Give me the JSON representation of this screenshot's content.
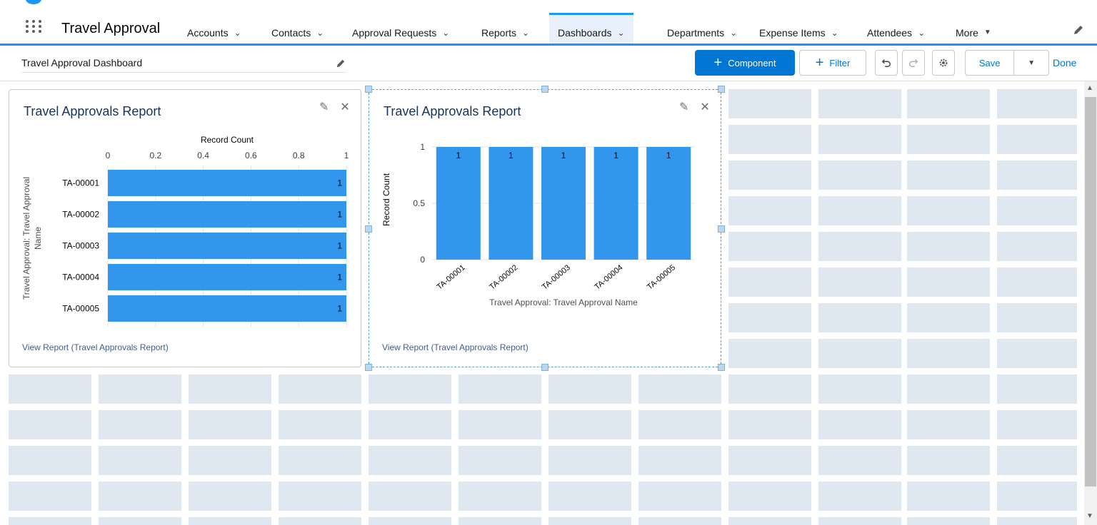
{
  "app": {
    "name": "Travel Approval"
  },
  "nav": {
    "items": [
      {
        "label": "Accounts",
        "left": 250
      },
      {
        "label": "Contacts",
        "left": 368
      },
      {
        "label": "Approval Requests",
        "left": 481
      },
      {
        "label": "Reports",
        "left": 662
      },
      {
        "label": "Dashboards",
        "left": 769
      },
      {
        "label": "Departments",
        "left": 922
      },
      {
        "label": "Expense Items",
        "left": 1051
      },
      {
        "label": "Attendees",
        "left": 1202
      }
    ],
    "more_label": "More"
  },
  "dashboard": {
    "title": "Travel Approval Dashboard",
    "component_label": "Component",
    "filter_label": "Filter",
    "save_label": "Save",
    "done_label": "Done"
  },
  "widgets": [
    {
      "title": "Travel Approvals Report",
      "link": "View Report (Travel Approvals Report)",
      "chart_data": {
        "type": "bar",
        "orientation": "horizontal",
        "categories": [
          "TA-00001",
          "TA-00002",
          "TA-00003",
          "TA-00004",
          "TA-00005"
        ],
        "values": [
          1,
          1,
          1,
          1,
          1
        ],
        "xlabel": "Record Count",
        "ylabel": "Travel Approval: Travel Approval Name",
        "ticks": [
          "0",
          "0.2",
          "0.4",
          "0.6",
          "0.8",
          "1"
        ],
        "xlim": [
          0,
          1
        ],
        "data_labels": [
          "1",
          "1",
          "1",
          "1",
          "1"
        ],
        "color": "#3296ed"
      }
    },
    {
      "title": "Travel Approvals Report",
      "link": "View Report (Travel Approvals Report)",
      "chart_data": {
        "type": "bar",
        "orientation": "vertical",
        "categories": [
          "TA-00001",
          "TA-00002",
          "TA-00003",
          "TA-00004",
          "TA-00005"
        ],
        "values": [
          1,
          1,
          1,
          1,
          1
        ],
        "xlabel": "Travel Approval: Travel Approval Name",
        "ylabel": "Record Count",
        "ticks": [
          "0",
          "0.5",
          "1"
        ],
        "ylim": [
          0,
          1
        ],
        "data_labels": [
          "1",
          "1",
          "1",
          "1",
          "1"
        ],
        "color": "#3296ed"
      }
    }
  ],
  "colors": {
    "brand": "#0176d3",
    "accent": "#1b96ff",
    "grid_cell": "#dfe7f1",
    "bar": "#3296ed"
  }
}
